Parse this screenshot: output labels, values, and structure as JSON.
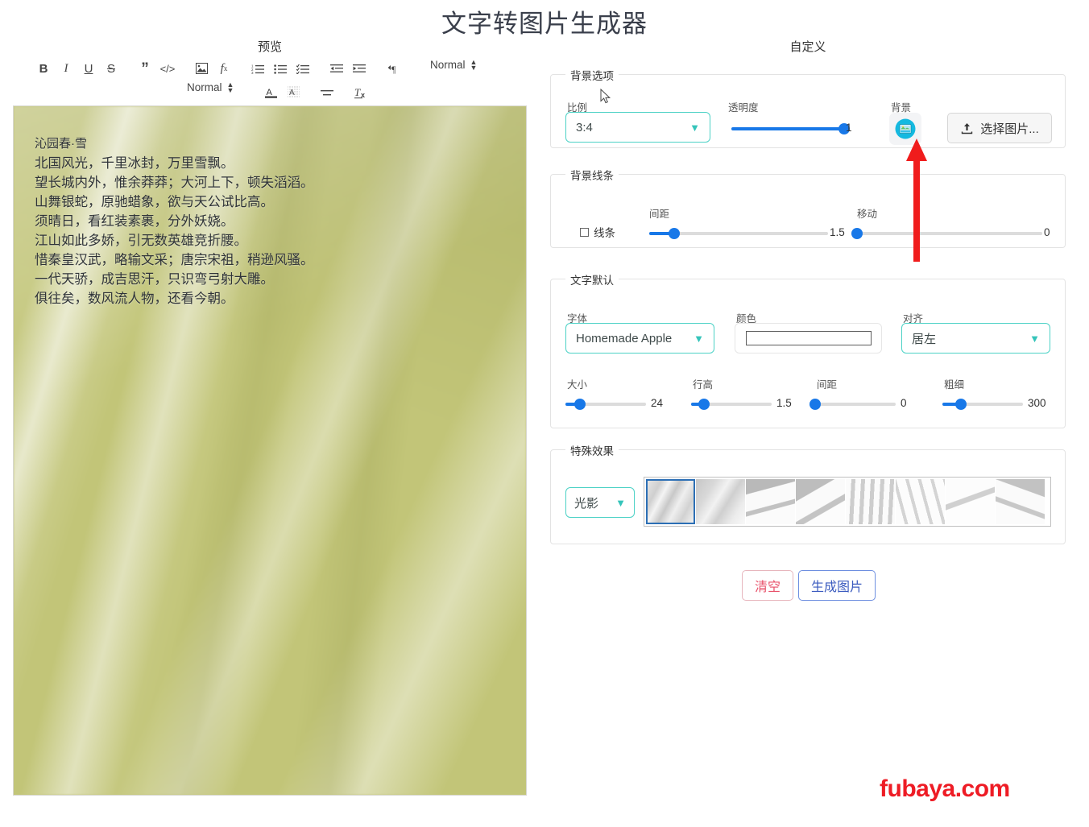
{
  "app": {
    "title": "文字转图片生成器",
    "watermark": "fubaya.com"
  },
  "columns": {
    "preview_header": "预览",
    "customize_header": "自定义"
  },
  "editor": {
    "toolbar_row1": [
      {
        "name": "bold",
        "label": "B"
      },
      {
        "name": "italic",
        "label": "I"
      },
      {
        "name": "underline",
        "label": "U"
      },
      {
        "name": "strikethrough",
        "label": "S"
      },
      {
        "name": "blockquote",
        "label": "”"
      },
      {
        "name": "code-block",
        "label": "</>"
      },
      {
        "name": "insert-image",
        "label": "image"
      },
      {
        "name": "formula",
        "label": "fx"
      },
      {
        "name": "ordered-list",
        "label": "1."
      },
      {
        "name": "bullet-list",
        "label": "•"
      },
      {
        "name": "check-list",
        "label": "✓"
      },
      {
        "name": "outdent",
        "label": "←"
      },
      {
        "name": "indent",
        "label": "→"
      },
      {
        "name": "text-direction",
        "label": "¶"
      }
    ],
    "heading_select_right": "Normal",
    "toolbar_row2": [
      {
        "name": "size-select",
        "label": "Normal"
      },
      {
        "name": "font-color",
        "label": "A"
      },
      {
        "name": "background-color",
        "label": "A"
      },
      {
        "name": "align",
        "label": "align"
      },
      {
        "name": "clear-format",
        "label": "Tx"
      }
    ]
  },
  "preview": {
    "lines": [
      "沁园春·雪",
      "北国风光，千里冰封，万里雪飘。",
      "望长城内外，惟余莽莽；大河上下，顿失滔滔。",
      "山舞银蛇，原驰蜡象，欲与天公试比高。",
      "须晴日，看红装素裹，分外妖娆。",
      "江山如此多娇，引无数英雄竞折腰。",
      "惜秦皇汉武，略输文采；唐宗宋祖，稍逊风骚。",
      "一代天骄，成吉思汗，只识弯弓射大雕。",
      "俱往矣，数风流人物，还看今朝。"
    ],
    "background_color": "#c2c578"
  },
  "background_options": {
    "legend": "背景选项",
    "ratio_label": "比例",
    "ratio_value": "3:4",
    "opacity_label": "透明度",
    "opacity_value": "1",
    "opacity_percent": 100,
    "background_label": "背景",
    "background_icon": "picture-icon",
    "upload_label": "选择图片...",
    "upload_icon": "upload-icon"
  },
  "background_lines": {
    "legend": "背景线条",
    "checkbox_label": "线条",
    "checkbox_checked": false,
    "spacing_label": "间距",
    "spacing_value": "1.5",
    "spacing_percent": 14,
    "move_label": "移动",
    "move_value": "0",
    "move_percent": 0
  },
  "text_defaults": {
    "legend": "文字默认",
    "font_label": "字体",
    "font_value": "Homemade Apple",
    "color_label": "颜色",
    "color_value": "#ffffff",
    "align_label": "对齐",
    "align_value": "居左",
    "size_label": "大小",
    "size_value": "24",
    "size_percent": 18,
    "lineheight_label": "行高",
    "lineheight_value": "1.5",
    "lineheight_percent": 16,
    "letterspacing_label": "间距",
    "letterspacing_value": "0",
    "letterspacing_percent": 0,
    "weight_label": "粗细",
    "weight_value": "300",
    "weight_percent": 23
  },
  "effects": {
    "legend": "特殊效果",
    "type_value": "光影",
    "thumbnails": [
      {
        "name": "effect-thumb-1",
        "selected": true
      },
      {
        "name": "effect-thumb-2",
        "selected": false
      },
      {
        "name": "effect-thumb-3",
        "selected": false
      },
      {
        "name": "effect-thumb-4",
        "selected": false
      },
      {
        "name": "effect-thumb-5",
        "selected": false
      },
      {
        "name": "effect-thumb-6",
        "selected": false
      },
      {
        "name": "effect-thumb-7",
        "selected": false
      },
      {
        "name": "effect-thumb-8",
        "selected": false
      }
    ]
  },
  "actions": {
    "clear_label": "清空",
    "generate_label": "生成图片"
  },
  "annotation": {
    "arrow_color": "#f01c1c",
    "points_at": "background-icon-button"
  },
  "colors": {
    "accent_blue": "#1878e8",
    "teal_border": "#4cd2c6",
    "watermark_red": "#ee1c25"
  }
}
